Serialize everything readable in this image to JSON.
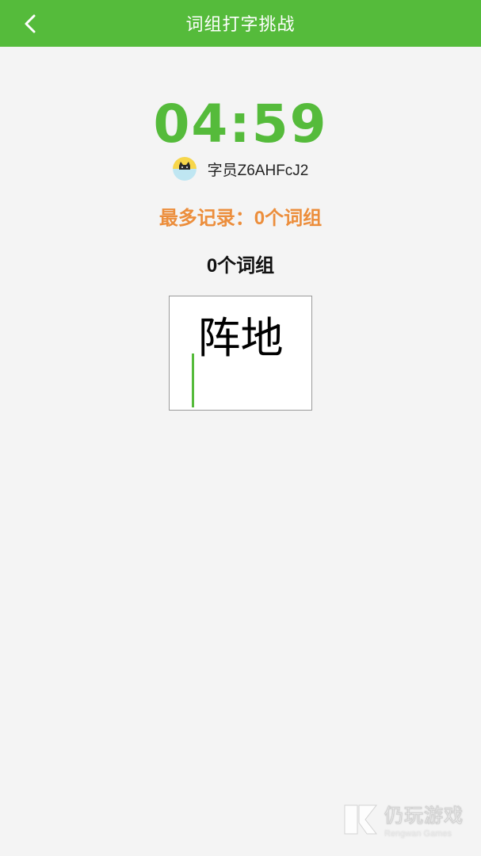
{
  "header": {
    "title": "词组打字挑战",
    "back_icon": "chevron-left-icon"
  },
  "timer": {
    "value": "04:59"
  },
  "user": {
    "name": "字员Z6AHFcJ2",
    "avatar_icon": "cat-avatar-icon"
  },
  "record": {
    "text": "最多记录：0个词组"
  },
  "count": {
    "text": "0个词组"
  },
  "challenge": {
    "word": "阵地"
  },
  "watermark": {
    "title": "仍玩游戏",
    "subtitle": "Rengwan Games"
  },
  "colors": {
    "brand_green": "#55bb3b",
    "record_orange": "#ec8e3c",
    "background": "#f4f4f4"
  }
}
